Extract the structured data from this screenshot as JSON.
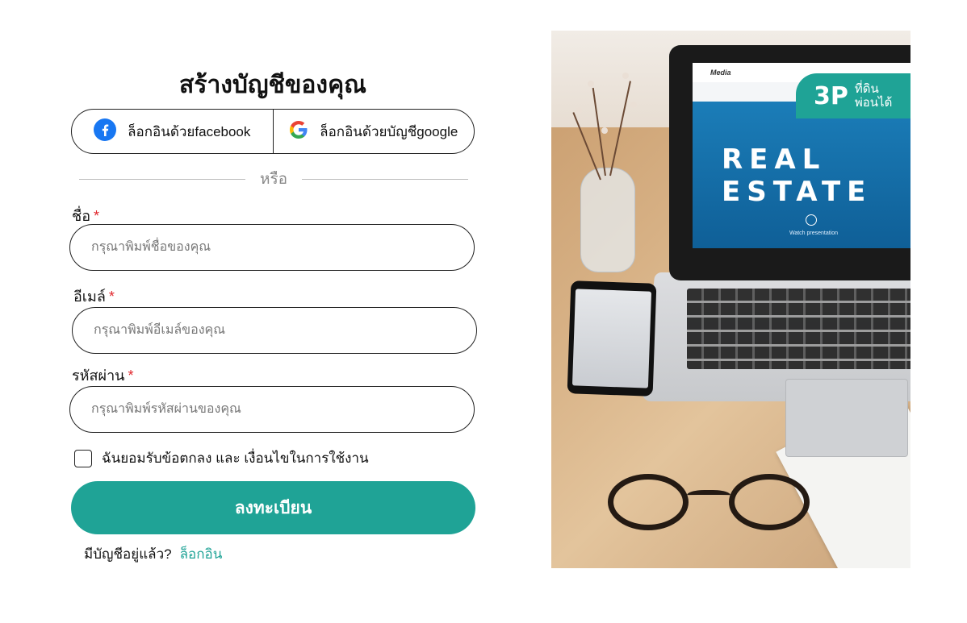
{
  "form": {
    "title": "สร้างบัญชีของคุณ",
    "facebook_label": "ล็อกอินด้วยfacebook",
    "google_label": "ล็อกอินด้วยบัญชีgoogle",
    "divider": "หรือ",
    "required_mark": "*",
    "name_label": "ชื่อ",
    "name_placeholder": "กรุณาพิมพ์ชื่อของคุณ",
    "email_label": "อีเมล์",
    "email_placeholder": "กรุณาพิมพ์อีเมล์ของคุณ",
    "password_label": "รหัสผ่าน",
    "password_placeholder": "กรุณาพิมพ์รหัสผ่านของคุณ",
    "terms_label": "ฉันยอมรับข้อตกลง และ เงื่อนไขในการใช้งาน",
    "submit_label": "ลงทะเบียน",
    "have_account": "มีบัญชีอยู่แล้ว?",
    "login_link": "ล็อกอิน"
  },
  "photo": {
    "screen_title": "REAL ESTATE",
    "screen_brand": "Media",
    "screen_sub": "Watch presentation",
    "badge_logo": "3P",
    "badge_text_1": "ที่ดิน",
    "badge_text_2": "พ่อนได้"
  },
  "colors": {
    "accent": "#1fa396",
    "required": "#e0262c"
  },
  "icons": [
    "facebook-icon",
    "google-icon"
  ]
}
